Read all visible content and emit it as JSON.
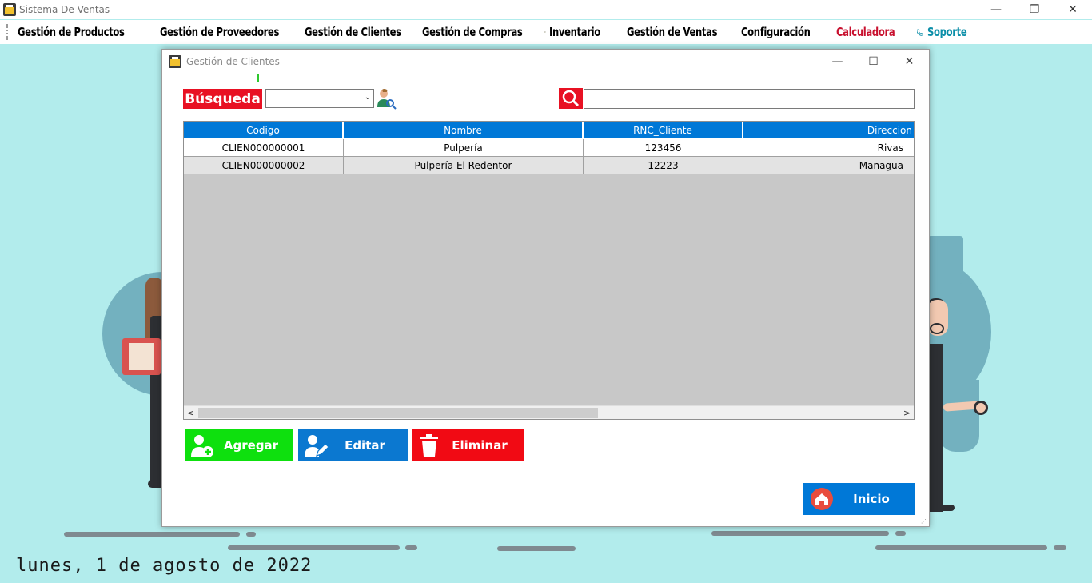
{
  "app": {
    "title": "Sistema De Ventas -",
    "controls": {
      "minimize": "—",
      "restore": "❐",
      "close": "✕"
    }
  },
  "menu": {
    "items": [
      {
        "label": "Gestión de Productos",
        "icon": "box-icon",
        "color": "#000000"
      },
      {
        "label": "Gestión de Proveedores",
        "icon": "supplier-icon",
        "color": "#000000"
      },
      {
        "label": "Gestión de Clientes",
        "icon": "client-icon",
        "color": "#000000"
      },
      {
        "label": "Gestión de Compras",
        "icon": "cart-icon",
        "color": "#000000"
      },
      {
        "label": "Inventario",
        "icon": "clipboard-icon",
        "color": "#000000"
      },
      {
        "label": "Gestión de Ventas",
        "icon": "sales-chart-icon",
        "color": "#000000"
      },
      {
        "label": "Configuración",
        "icon": "settings-icon",
        "color": "#000000"
      },
      {
        "label": "Calculadora",
        "icon": "calculator-icon",
        "color": "#c8102e"
      },
      {
        "label": "Soporte",
        "icon": "phone-icon",
        "color": "#0b8ea8"
      }
    ]
  },
  "dialog": {
    "title": "Gestión de Clientes",
    "controls": {
      "minimize": "—",
      "maximize": "☐",
      "close": "✕"
    },
    "search": {
      "label": "Búsqueda",
      "select_value": "",
      "input_value": "",
      "input_placeholder": ""
    },
    "grid": {
      "columns": [
        "Codigo",
        "Nombre",
        "RNC_Cliente",
        "Direccion"
      ],
      "rows": [
        [
          "CLIEN000000001",
          "Pulpería",
          "123456",
          "Rivas"
        ],
        [
          "CLIEN000000002",
          "Pulpería El Redentor",
          "12223",
          "Managua"
        ]
      ],
      "scroll_left": "<",
      "scroll_right": ">"
    },
    "buttons": {
      "agregar": "Agregar",
      "editar": "Editar",
      "eliminar": "Eliminar",
      "inicio": "Inicio"
    }
  },
  "status": {
    "date": "lunes, 1 de agosto de 2022"
  },
  "colors": {
    "background": "#b2ecec",
    "accent_blue": "#0078d7",
    "accent_red": "#e81123",
    "accent_green": "#0ee00e"
  }
}
